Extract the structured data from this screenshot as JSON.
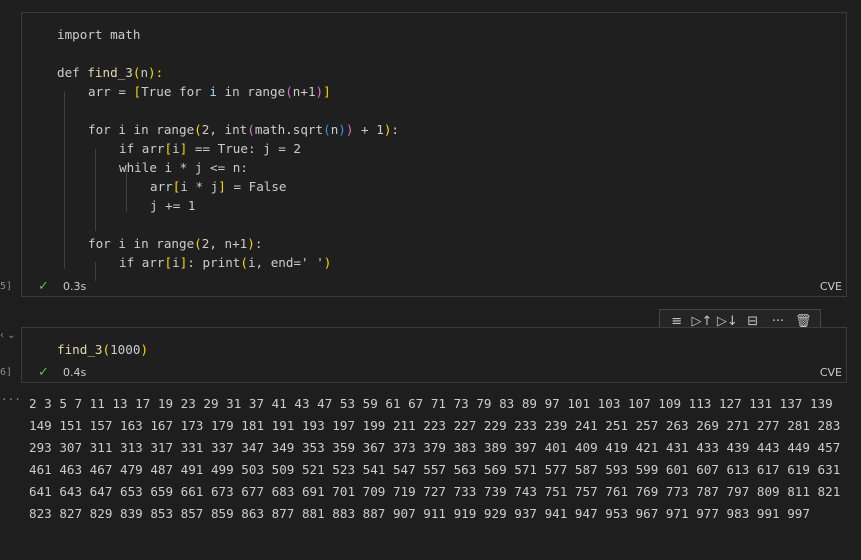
{
  "cell1": {
    "lines": {
      "l1": "import math",
      "l2_def": "def ",
      "l2_fn": "find_3",
      "l2_open": "(",
      "l2_arg": "n",
      "l2_close": "):",
      "l3_a": "arr = ",
      "l3_b1": "[",
      "l3_b": "True for ",
      "l3_i": "i",
      "l3_c": " in range",
      "l3_p1": "(",
      "l3_d": "n+1",
      "l3_p2": ")",
      "l3_b2": "]",
      "l5_a": "for i in range",
      "l5_p1": "(",
      "l5_b": "2, int",
      "l5_p2": "(",
      "l5_c": "math.sqrt",
      "l5_p3": "(",
      "l5_d": "n",
      "l5_p4": ")",
      "l5_p5": ")",
      "l5_e": " + 1",
      "l5_p6": ")",
      "l5_f": ":",
      "l6_a": "if arr",
      "l6_b1": "[",
      "l6_b": "i",
      "l6_b2": "]",
      "l6_c": " == True: j = 2",
      "l7": "while i * j <= n:",
      "l8_a": "arr",
      "l8_b1": "[",
      "l8_b": "i * j",
      "l8_b2": "]",
      "l8_c": " = False",
      "l9": "j += 1",
      "l11_a": "for i in range",
      "l11_p1": "(",
      "l11_b": "2, n+1",
      "l11_p2": ")",
      "l11_c": ":",
      "l12_a": "if arr",
      "l12_b1": "[",
      "l12_b": "i",
      "l12_b2": "]",
      "l12_c": ": print",
      "l12_p1": "(",
      "l12_d": "i, end=' '",
      "l12_p2": ")"
    },
    "exec_count": "5]",
    "status_check": "✓",
    "time": "0.3s",
    "kernel": "CVE"
  },
  "cell2": {
    "fn": "find_3",
    "open": "(",
    "arg": "1000",
    "close": ")",
    "exec_count": "6]",
    "status_check": "✓",
    "time": "0.4s",
    "kernel": "CVE"
  },
  "toolbar": {
    "run_by_line": "≡",
    "execute_above": "▷↑",
    "execute_below": "▷↓",
    "split": "⊟",
    "more": "···",
    "delete": "🗑"
  },
  "output": {
    "dots": "···",
    "text": "2 3 5 7 11 13 17 19 23 29 31 37 41 43 47 53 59 61 67 71 73 79 83 89 97 101 103 107 109 113 127 131 137 139 149 151 157 163 167 173 179 181 191 193 197 199 211 223 227 229 233 239 241 251 257 263 269 271 277 281 283 293 307 311 313 317 331 337 347 349 353 359 367 373 379 383 389 397 401 409 419 421 431 433 439 443 449 457 461 463 467 479 487 491 499 503 509 521 523 541 547 557 563 569 571 577 587 593 599 601 607 613 617 619 631 641 643 647 653 659 661 673 677 683 691 701 709 719 727 733 739 743 751 757 761 769 773 787 797 809 811 821 823 827 829 839 853 857 859 863 877 881 883 887 907 911 919 929 937 941 947 953 967 971 977 983 991 997"
  },
  "gutter": {
    "chevron": "‹ ⌄"
  }
}
